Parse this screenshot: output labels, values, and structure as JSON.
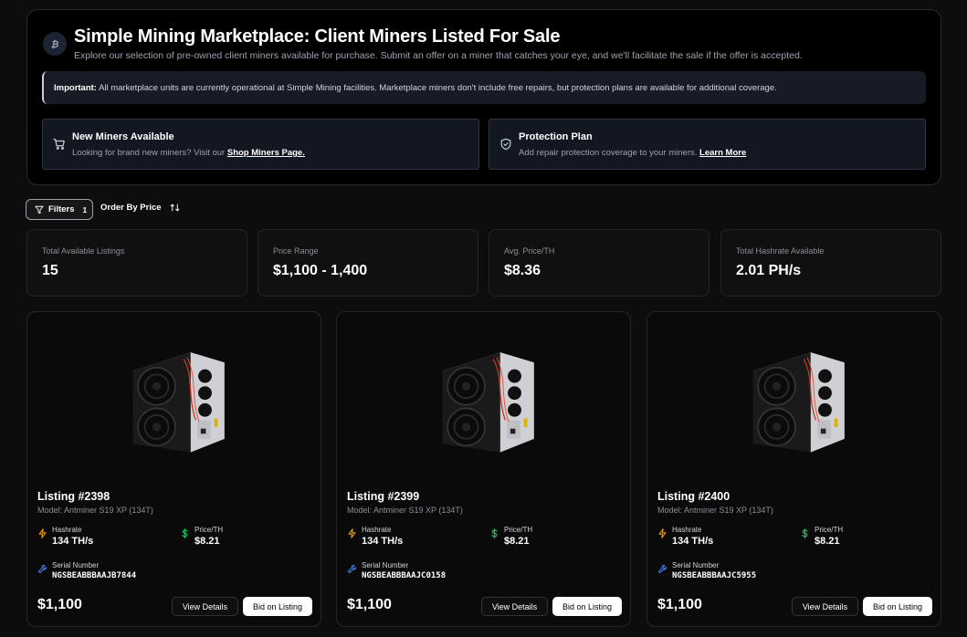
{
  "hero": {
    "title": "Simple Mining Marketplace: Client Miners Listed For Sale",
    "subtitle": "Explore our selection of pre-owned client miners available for purchase. Submit an offer on a miner that catches your eye, and we'll facilitate the sale if the offer is accepted.",
    "notice_strong": "Important:",
    "notice_text": " All marketplace units are currently operational at Simple Mining facilities. Marketplace miners don't include free repairs, but protection plans are available for additional coverage.",
    "promos": [
      {
        "icon": "cart-icon",
        "title": "New Miners Available",
        "desc": "Looking for brand new miners? Visit our ",
        "link": "Shop Miners Page."
      },
      {
        "icon": "shield-icon",
        "title": "Protection Plan",
        "desc": "Add repair protection coverage to your miners. ",
        "link": "Learn More"
      }
    ]
  },
  "toolbar": {
    "filters_label": "Filters",
    "filters_count": "1",
    "order_label": "Order By Price"
  },
  "stats": [
    {
      "label": "Total Available Listings",
      "value": "15"
    },
    {
      "label": "Price Range",
      "value": "$1,100 - 1,400"
    },
    {
      "label": "Avg. Price/TH",
      "value": "$8.36"
    },
    {
      "label": "Total Hashrate Available",
      "value": "2.01 PH/s"
    }
  ],
  "listing_labels": {
    "hashrate": "Hashrate",
    "price_th": "Price/TH",
    "serial": "Serial Number",
    "view": "View Details",
    "bid": "Bid on Listing"
  },
  "listings": [
    {
      "title": "Listing #2398",
      "model": "Model: Antminer S19 XP (134T)",
      "hashrate": "134 TH/s",
      "price_th": "$8.21",
      "serial": "NGSBEABBBAAJB7844",
      "price": "$1,100"
    },
    {
      "title": "Listing #2399",
      "model": "Model: Antminer S19 XP (134T)",
      "hashrate": "134 TH/s",
      "price_th": "$8.21",
      "serial": "NGSBEABBBAAJC0158",
      "price": "$1,100"
    },
    {
      "title": "Listing #2400",
      "model": "Model: Antminer S19 XP (134T)",
      "hashrate": "134 TH/s",
      "price_th": "$8.21",
      "serial": "NGSBEABBBAAJC5955",
      "price": "$1,100"
    }
  ],
  "colors": {
    "bolt": "#f59e0b",
    "dollar": "#22c55e",
    "wrench": "#3b82f6"
  }
}
